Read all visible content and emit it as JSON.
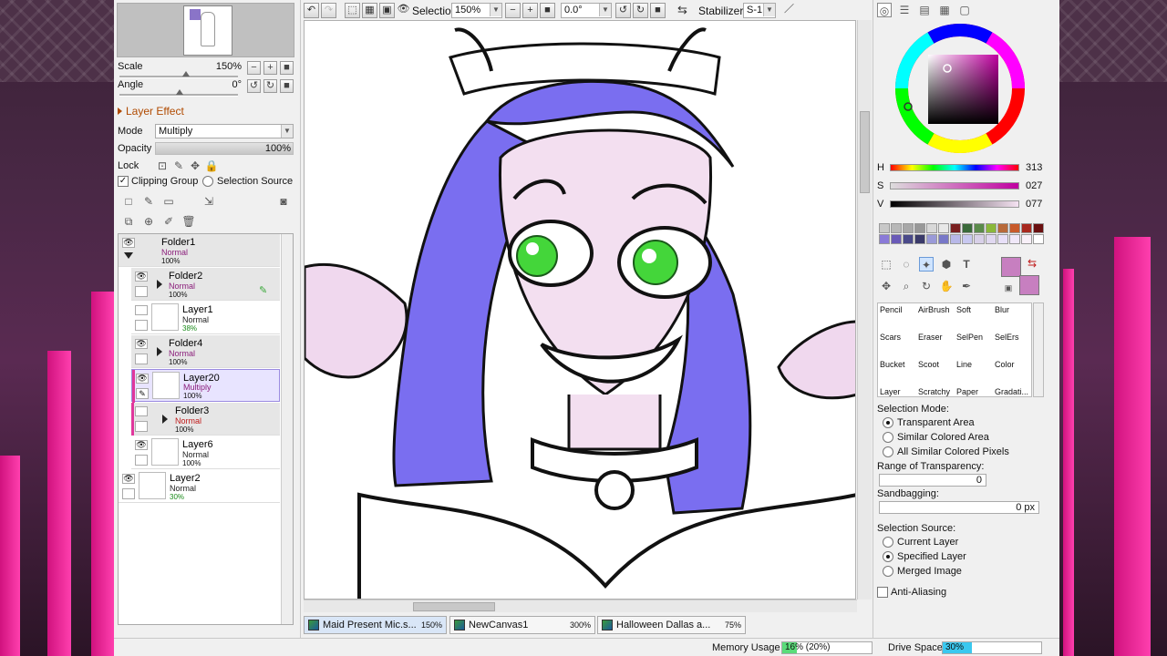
{
  "navigator": {
    "scale_label": "Scale",
    "scale_value": "150%",
    "angle_label": "Angle",
    "angle_value": "0°"
  },
  "layer_effect": {
    "title": "Layer Effect",
    "mode_label": "Mode",
    "mode_value": "Multiply",
    "opacity_label": "Opacity",
    "opacity_value": "100%",
    "lock_label": "Lock",
    "clipping_group": "Clipping Group",
    "selection_source": "Selection Source"
  },
  "layers": [
    {
      "name": "Folder1",
      "mode": "Normal",
      "opacity": "100%"
    },
    {
      "name": "Folder2",
      "mode": "Normal",
      "opacity": "100%"
    },
    {
      "name": "Layer1",
      "mode": "Normal",
      "opacity": "38%"
    },
    {
      "name": "Folder4",
      "mode": "Normal",
      "opacity": "100%"
    },
    {
      "name": "Layer20",
      "mode": "Multiply",
      "opacity": "100%"
    },
    {
      "name": "Folder3",
      "mode": "Normal",
      "opacity": "100%"
    },
    {
      "name": "Layer6",
      "mode": "Normal",
      "opacity": "100%"
    },
    {
      "name": "Layer2",
      "mode": "Normal",
      "opacity": "30%"
    }
  ],
  "toolbar": {
    "selection_label": "Selection",
    "zoom_value": "150%",
    "angle_value": "0.0°",
    "stabilizer_label": "Stabilizer",
    "stabilizer_value": "S-1"
  },
  "tabs": [
    {
      "label": "Maid Present Mic.s...",
      "zoom": "150%"
    },
    {
      "label": "NewCanvas1",
      "zoom": "300%"
    },
    {
      "label": "Halloween Dallas a...",
      "zoom": "75%"
    }
  ],
  "color": {
    "h_label": "H",
    "h_value": "313",
    "s_label": "S",
    "s_value": "027",
    "v_label": "V",
    "v_value": "077",
    "primary": "#c77fc0",
    "swatches": [
      "#c8c8c8",
      "#b8b8b8",
      "#a8a8a8",
      "#989898",
      "#d8d8d8",
      "#e8e8e8",
      "#7a2020",
      "#3a6a3a",
      "#5a8a4a",
      "#8ab83a",
      "#b86a3a",
      "#c85a2a",
      "#a8281e",
      "#6a1010",
      "#8a7ad8",
      "#6a5ab8",
      "#4a4a8a",
      "#3a3a6a",
      "#9a9ad8",
      "#7878c8",
      "#b8b8e8",
      "#c8c8f0",
      "#d8d0e8",
      "#e0d8f0",
      "#e8e0f8",
      "#f0e8f8",
      "#f8f0f8",
      "#ffffff"
    ]
  },
  "tools": {
    "row1": [
      "Pencil",
      "AirBrush",
      "Soft",
      "Blur"
    ],
    "row2": [
      "Scars",
      "Eraser",
      "SelPen",
      "SelErs"
    ],
    "row3": [
      "Bucket",
      "Scoot",
      "Line",
      "Color"
    ],
    "row4": [
      "Layer",
      "Scratchy",
      "Paper",
      "Gradati..."
    ]
  },
  "selection": {
    "mode_label": "Selection Mode:",
    "modes": [
      "Transparent Area",
      "Similar Colored Area",
      "All Similar Colored Pixels"
    ],
    "range_label": "Range of Transparency:",
    "range_value": "0",
    "sandbag_label": "Sandbagging:",
    "sandbag_value": "0 px",
    "source_label": "Selection Source:",
    "sources": [
      "Current Layer",
      "Specified Layer",
      "Merged Image"
    ],
    "anti_aliasing": "Anti-Aliasing"
  },
  "status": {
    "memory_label": "Memory Usage",
    "memory_value": "16% (20%)",
    "memory_fraction": 0.16,
    "drive_label": "Drive Space",
    "drive_value": "30%",
    "drive_fraction": 0.3
  }
}
